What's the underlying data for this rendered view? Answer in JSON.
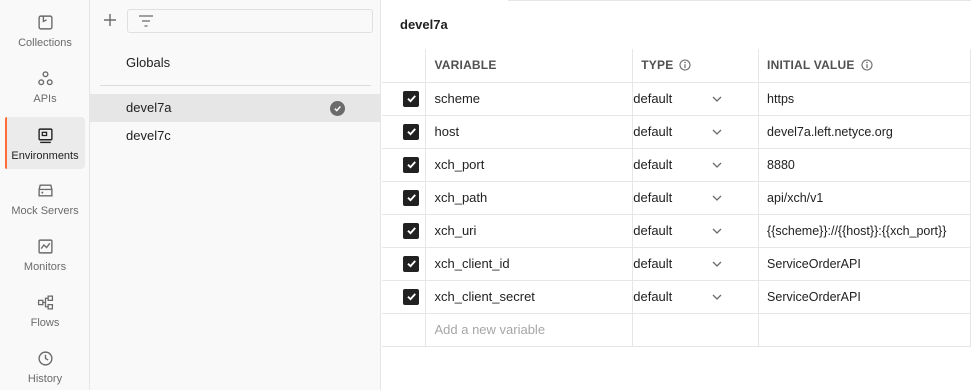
{
  "sidebar": {
    "items": [
      {
        "label": "Collections",
        "icon": "collections-icon"
      },
      {
        "label": "APIs",
        "icon": "apis-icon"
      },
      {
        "label": "Environments",
        "icon": "environments-icon"
      },
      {
        "label": "Mock Servers",
        "icon": "mock-servers-icon"
      },
      {
        "label": "Monitors",
        "icon": "monitors-icon"
      },
      {
        "label": "Flows",
        "icon": "flows-icon"
      },
      {
        "label": "History",
        "icon": "history-icon"
      }
    ],
    "active": "Environments",
    "accent": "#ff6c37"
  },
  "env_list": {
    "globals_label": "Globals",
    "environments": [
      {
        "name": "devel7a",
        "active": true
      },
      {
        "name": "devel7c",
        "active": false
      }
    ]
  },
  "main": {
    "title": "devel7a",
    "columns": {
      "variable": "VARIABLE",
      "type": "TYPE",
      "initial_value": "INITIAL VALUE"
    },
    "rows": [
      {
        "checked": true,
        "variable": "scheme",
        "type": "default",
        "initial": "https"
      },
      {
        "checked": true,
        "variable": "host",
        "type": "default",
        "initial": "devel7a.left.netyce.org"
      },
      {
        "checked": true,
        "variable": "xch_port",
        "type": "default",
        "initial": "8880"
      },
      {
        "checked": true,
        "variable": "xch_path",
        "type": "default",
        "initial": "api/xch/v1"
      },
      {
        "checked": true,
        "variable": "xch_uri",
        "type": "default",
        "initial": "{{scheme}}://{{host}}:{{xch_port}}"
      },
      {
        "checked": true,
        "variable": "xch_client_id",
        "type": "default",
        "initial": "ServiceOrderAPI"
      },
      {
        "checked": true,
        "variable": "xch_client_secret",
        "type": "default",
        "initial": "ServiceOrderAPI"
      }
    ],
    "new_variable_placeholder": "Add a new variable"
  }
}
